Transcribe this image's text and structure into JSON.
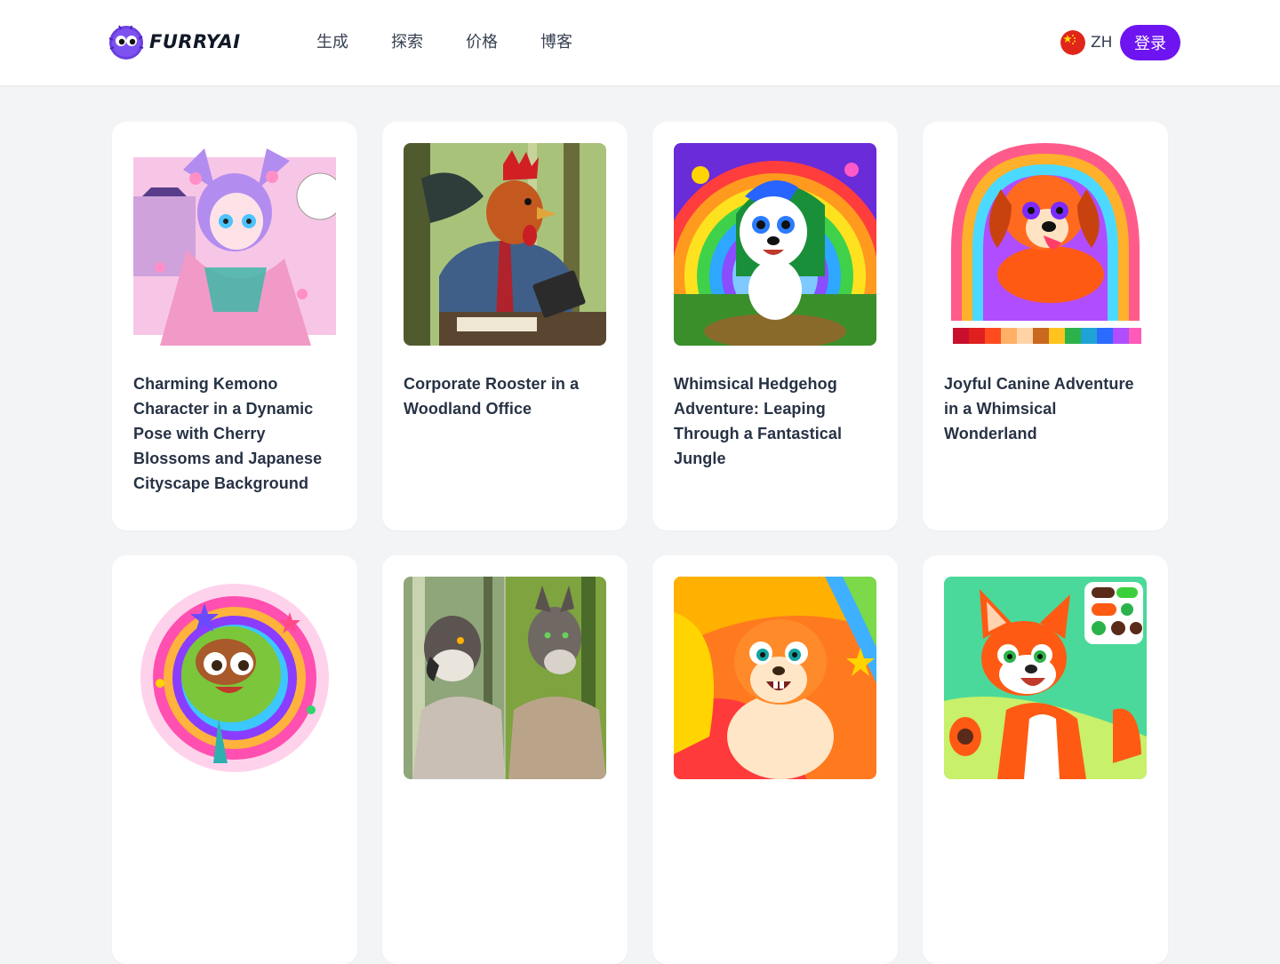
{
  "brand": {
    "name": "FURRYAI",
    "accent": "#6d14f0"
  },
  "nav": {
    "items": [
      {
        "label": "生成"
      },
      {
        "label": "探索"
      },
      {
        "label": "价格"
      },
      {
        "label": "博客"
      }
    ]
  },
  "language": {
    "code": "ZH",
    "flag_icon": "china-flag-icon"
  },
  "auth": {
    "login_label": "登录"
  },
  "gallery": {
    "cards": [
      {
        "title": "Charming Kemono Character in a Dynamic Pose with Cherry Blossoms and Japanese Cityscape Background",
        "image": "anime-fox-girl-kimono"
      },
      {
        "title": "Corporate Rooster in a Woodland Office",
        "image": "rooster-businessman-forest"
      },
      {
        "title": "Whimsical Hedgehog Adventure: Leaping Through a Fantastical Jungle",
        "image": "cartoon-hedgehog-rainbow"
      },
      {
        "title": "Joyful Canine Adventure in a Whimsical Wonderland",
        "image": "cartoon-dog-rainbow"
      },
      {
        "title": "",
        "image": "fluffy-rainbow-creature"
      },
      {
        "title": "",
        "image": "eagle-and-wolf-warriors"
      },
      {
        "title": "",
        "image": "cartoon-squirrel-rainbow"
      },
      {
        "title": "",
        "image": "cartoon-fox-palette"
      }
    ]
  }
}
